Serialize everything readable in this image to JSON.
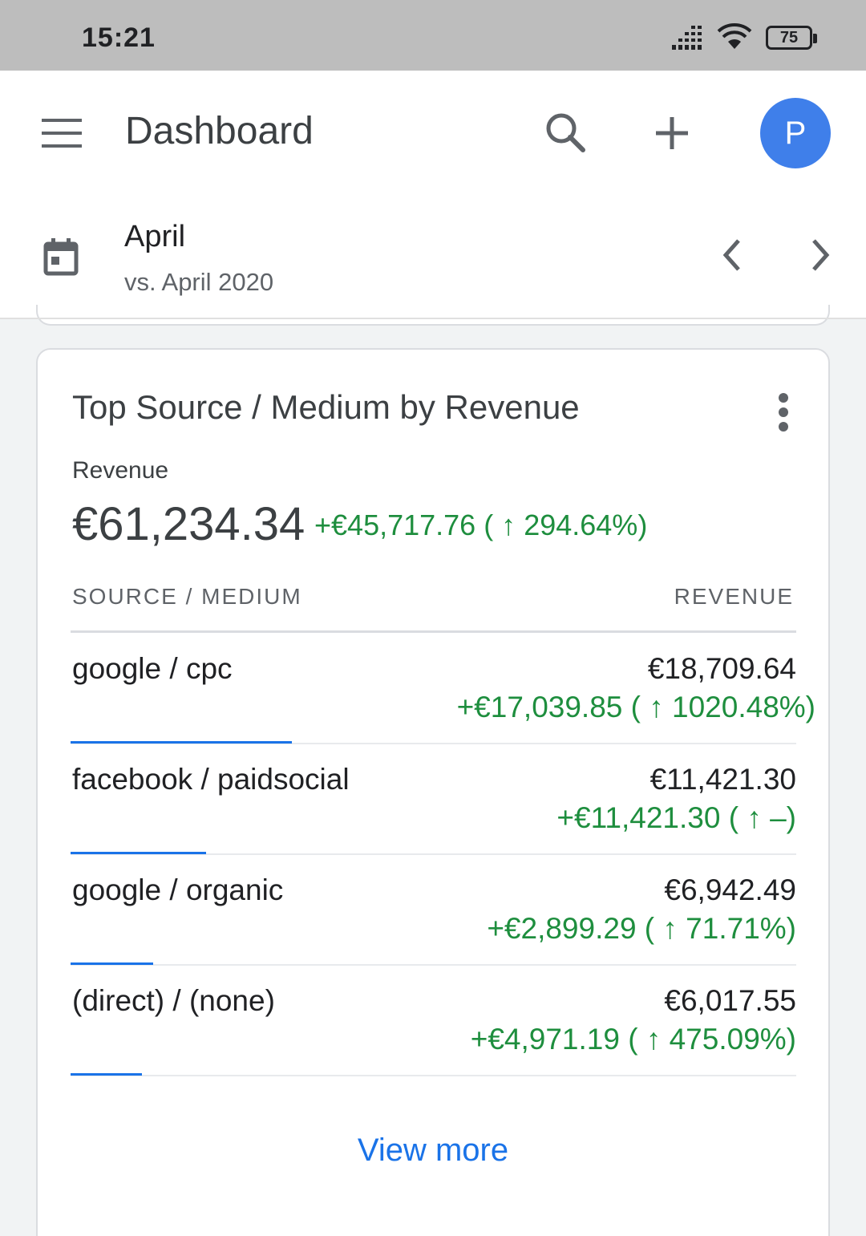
{
  "status_bar": {
    "time": "15:21",
    "battery": "75"
  },
  "header": {
    "title": "Dashboard",
    "avatar_initial": "P"
  },
  "date_range": {
    "label": "April",
    "comparison": "vs. April 2020"
  },
  "card": {
    "title": "Top Source / Medium by Revenue",
    "metric_label": "Revenue",
    "metric_value": "€61,234.34",
    "metric_delta": "+€45,717.76 ( ↑ 294.64%)",
    "columns": {
      "source": "SOURCE / MEDIUM",
      "revenue": "REVENUE"
    },
    "rows": [
      {
        "name": "google / cpc",
        "value": "€18,709.64",
        "delta": "+€17,039.85 ( ↑ 1020.48%)",
        "share": 0.3055
      },
      {
        "name": "facebook / paidsocial",
        "value": "€11,421.30",
        "delta": "+€11,421.30 ( ↑ –)",
        "share": 0.1865
      },
      {
        "name": "google / organic",
        "value": "€6,942.49",
        "delta": "+€2,899.29 ( ↑ 71.71%)",
        "share": 0.1134
      },
      {
        "name": "(direct) / (none)",
        "value": "€6,017.55",
        "delta": "+€4,971.19 ( ↑ 475.09%)",
        "share": 0.0983
      }
    ],
    "view_more": "View more"
  },
  "icons": {
    "menu": "menu-icon",
    "search": "search-icon",
    "add": "add-icon",
    "calendar": "calendar-icon",
    "prev": "chevron-left-icon",
    "next": "chevron-right-icon",
    "more": "more-vert-icon"
  },
  "colors": {
    "accent": "#1a73e8",
    "positive": "#1e8e3e",
    "avatar": "#3f7fea"
  }
}
